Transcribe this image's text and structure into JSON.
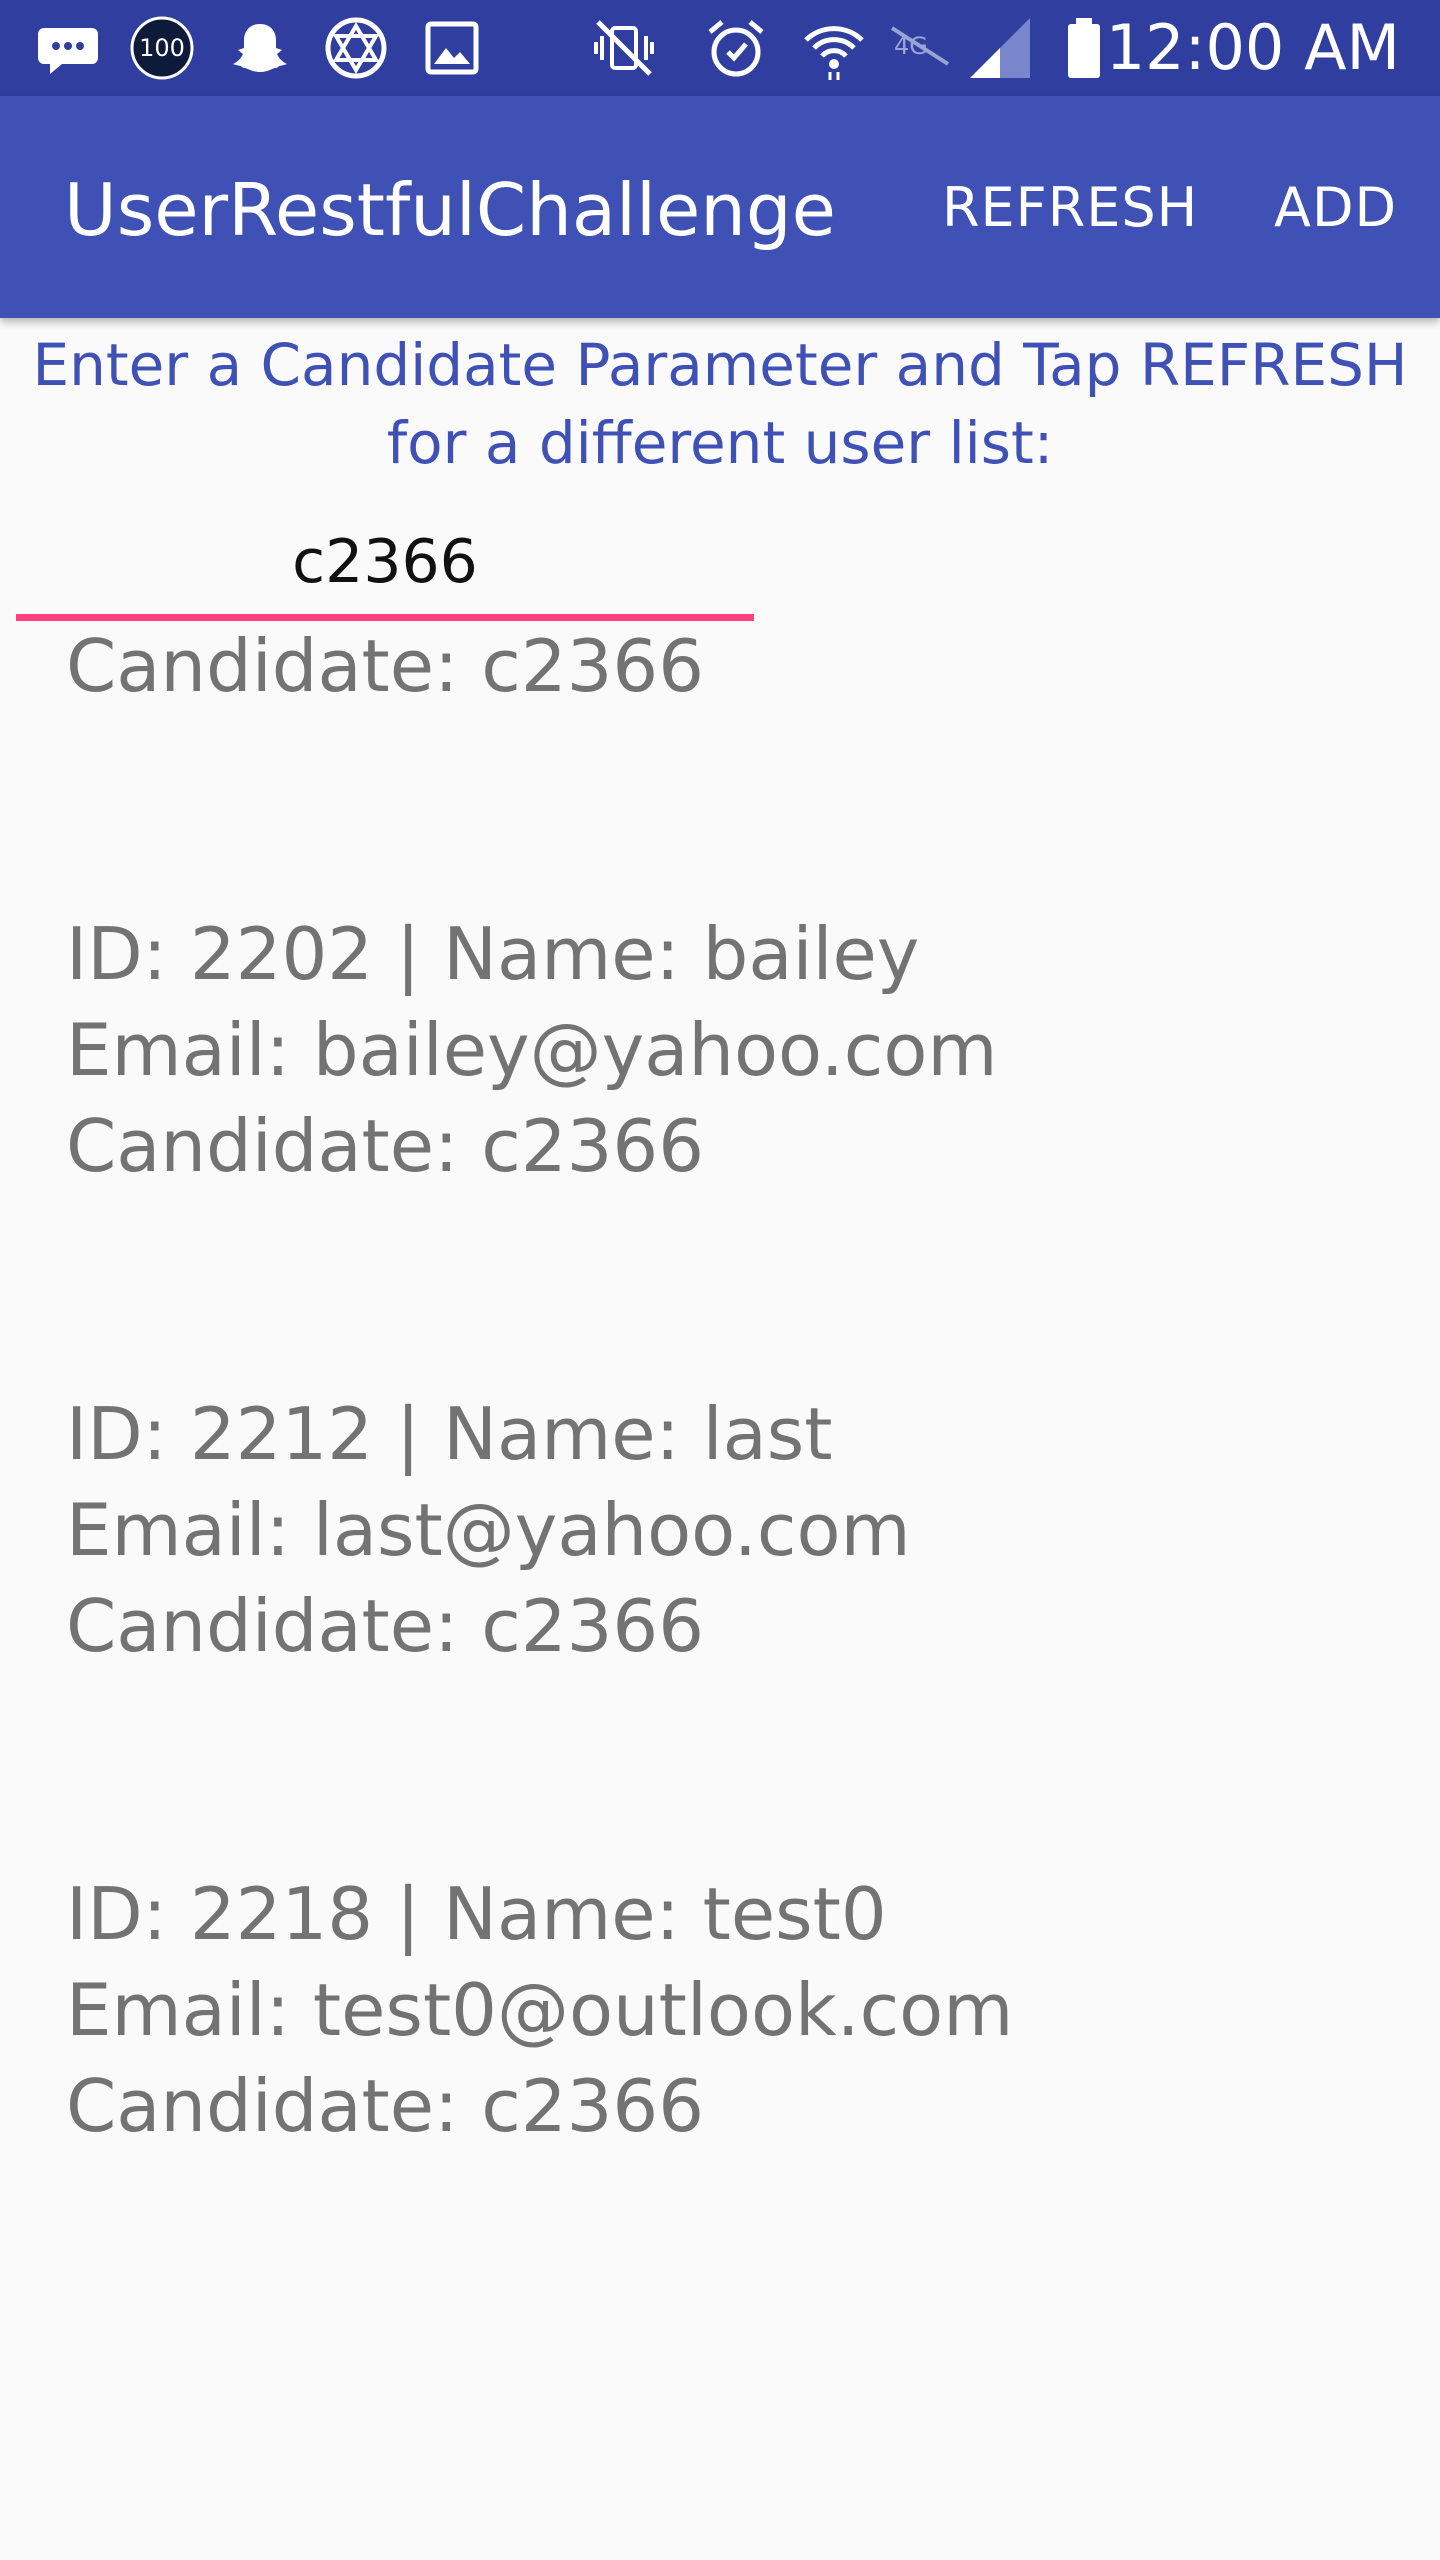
{
  "status_bar": {
    "time": "12:00 AM",
    "notification_badge": "100",
    "icons": [
      "messenger-icon",
      "badge-100-icon",
      "snapchat-icon",
      "settings-icon",
      "image-icon",
      "mute-icon",
      "alarm-icon",
      "wifi-icon",
      "data-off-icon",
      "signal-icon",
      "battery-icon"
    ]
  },
  "app_bar": {
    "title": "UserRestfulChallenge",
    "refresh_label": "REFRESH",
    "add_label": "ADD"
  },
  "instruction": {
    "text": "Enter a Candidate Parameter and Tap REFRESH for a different user list:"
  },
  "candidate_input": {
    "value": "c2366"
  },
  "users": [
    {
      "id_name": "",
      "email": "",
      "candidate": "Candidate: c2366"
    },
    {
      "id_name": "ID: 2202 | Name: bailey",
      "email": "Email: bailey@yahoo.com",
      "candidate": "Candidate: c2366"
    },
    {
      "id_name": "ID: 2212 | Name: last",
      "email": "Email: last@yahoo.com",
      "candidate": "Candidate: c2366"
    },
    {
      "id_name": "ID: 2218 | Name: test0",
      "email": "Email: test0@outlook.com",
      "candidate": "Candidate: c2366"
    }
  ],
  "colors": {
    "status_bar": "#303f9f",
    "app_bar": "#3f51b5",
    "accent": "#ff4081",
    "instruction_text": "#3f51b5",
    "list_text": "#737373",
    "background": "#fafafa"
  }
}
